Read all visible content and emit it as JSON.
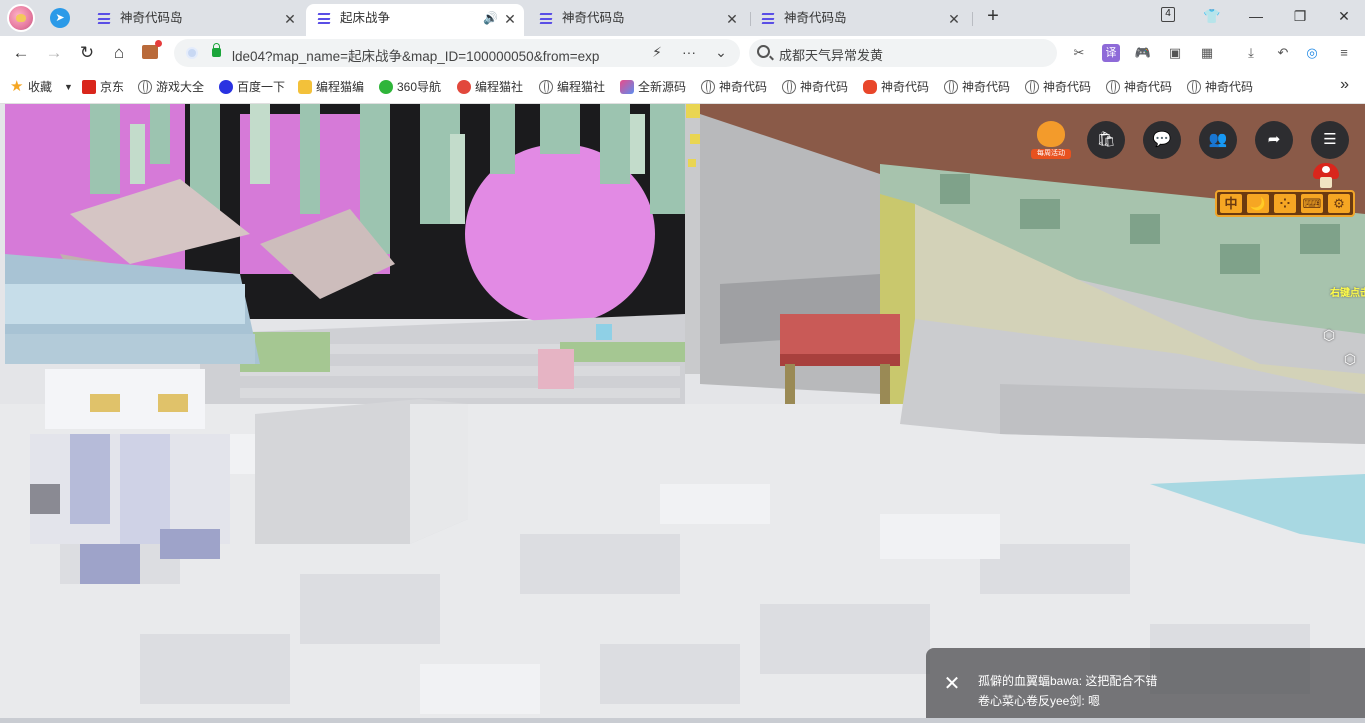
{
  "tabs": [
    {
      "label": "神奇代码岛",
      "active": false
    },
    {
      "label": "起床战争",
      "active": true,
      "audio": "🔊"
    },
    {
      "label": "神奇代码岛",
      "active": false
    },
    {
      "label": "神奇代码岛",
      "active": false
    }
  ],
  "tab_close_glyph": "✕",
  "new_tab_glyph": "+",
  "tab_count": "4",
  "window_controls": {
    "minimize": "—",
    "restore": "❐",
    "close": "✕"
  },
  "toolbar": {
    "back": "←",
    "forward": "→",
    "reload": "↻",
    "home": "⌂",
    "url": "lde04?map_name=起床战争&map_ID=100000050&from=exp",
    "lightning": "⚡",
    "more": "···",
    "dropdown": "⌄",
    "search_text": "成都天气异常发黄",
    "right_icons": [
      "✂",
      "译",
      "🎮",
      "▣",
      "▦",
      "⤓",
      "↶",
      "◎",
      "≡"
    ]
  },
  "bookmarks": [
    {
      "label": "收藏",
      "icon": "star-icon"
    },
    {
      "label": "京东",
      "icon": "jd-icon"
    },
    {
      "label": "游戏大全",
      "icon": "globe-icon"
    },
    {
      "label": "百度一下",
      "icon": "baidu-icon"
    },
    {
      "label": "编程猫编",
      "icon": "codemao-icon"
    },
    {
      "label": "360导航",
      "icon": "360-icon"
    },
    {
      "label": "编程猫社",
      "icon": "codemao-community-icon"
    },
    {
      "label": "编程猫社",
      "icon": "globe-icon"
    },
    {
      "label": "全新源码",
      "icon": "source-icon"
    },
    {
      "label": "神奇代码",
      "icon": "globe-icon"
    },
    {
      "label": "神奇代码",
      "icon": "globe-icon"
    },
    {
      "label": "神奇代码",
      "icon": "flower-icon"
    },
    {
      "label": "神奇代码",
      "icon": "globe-icon"
    },
    {
      "label": "神奇代码",
      "icon": "globe-icon"
    },
    {
      "label": "神奇代码",
      "icon": "globe-icon"
    },
    {
      "label": "神奇代码",
      "icon": "globe-icon"
    }
  ],
  "bookmarks_more": "»",
  "game": {
    "event_label": "每周活动",
    "hud_icons": [
      "shop-icon",
      "chat-icon",
      "friends-icon",
      "share-icon",
      "menu-icon"
    ],
    "hud_glyphs": [
      "🛍",
      "💬",
      "👥",
      "➦",
      "☰"
    ],
    "gamebar": [
      "中",
      "🌙",
      "⁘",
      "⌨",
      "⚙"
    ],
    "right_click_tip": "右键点击",
    "hex_glyph": "⬡",
    "chat_close": "✕",
    "chat_messages": [
      "孤僻的血翼蝠bawa: 这把配合不错",
      "卷心菜心卷反yee剑: 嗯"
    ]
  }
}
